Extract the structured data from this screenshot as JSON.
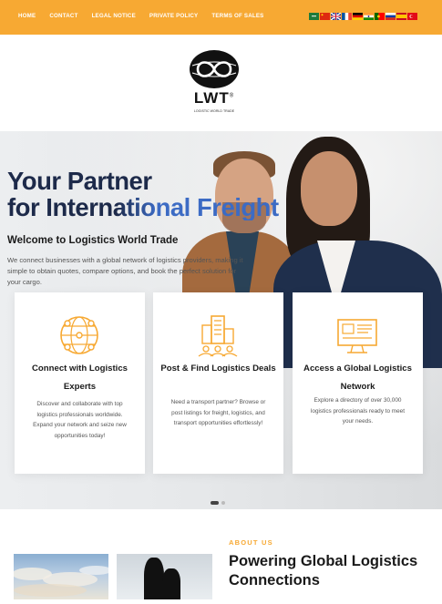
{
  "nav": {
    "items": [
      "HOME",
      "CONTACT",
      "LEGAL NOTICE",
      "PRIVATE POLICY",
      "TERMS OF SALES"
    ]
  },
  "languages": [
    "Arabic",
    "Chinese",
    "English",
    "French",
    "German",
    "Hindi",
    "Portuguese",
    "Russian",
    "Spanish",
    "Turkish"
  ],
  "logo": {
    "name": "LWT",
    "tagline": "LOGISTIC WORLD TRADE",
    "registered": "®"
  },
  "hero": {
    "title_line1": "Your Partner",
    "title_line2": "for International Freight",
    "subtitle": "Welcome to Logistics World Trade",
    "description": "We connect businesses with a global network of logistics providers, making it simple to obtain quotes, compare options, and book the perfect solution for your cargo."
  },
  "cards": [
    {
      "title": "Connect with Logistics Experts",
      "description": "Discover and collaborate with top logistics professionals worldwide. Expand your network and seize new opportunities today!",
      "icon": "network-globe-icon"
    },
    {
      "title": "Post & Find Logistics Deals",
      "description": "Need a transport partner? Browse or post listings for freight, logistics, and transport opportunities effortlessly!",
      "icon": "city-buildings-icon"
    },
    {
      "title": "Access a Global Logistics Network",
      "description": "Explore a directory of over 30,000 logistics professionals ready to meet your needs.",
      "icon": "monitor-directory-icon"
    }
  ],
  "carousel": {
    "current": 1,
    "total": 2
  },
  "about": {
    "tag": "ABOUT US",
    "title": "Powering Global Logistics Connections"
  },
  "colors": {
    "brand_orange": "#f7a933",
    "navy": "#1d2a4a",
    "accent_blue": "#3c6bc4"
  }
}
